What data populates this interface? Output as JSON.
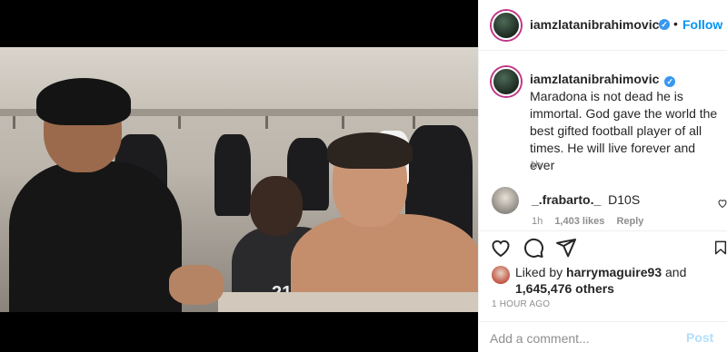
{
  "post": {
    "username": "iamzlatanibrahimovic",
    "verified_icon": "verified-badge-icon",
    "follow_label": "Follow",
    "dot_separator": "•",
    "caption_text": "Maradona is not dead he is immortal. God gave the world the best gifted football player of all times. He will live forever and ever",
    "caption_time": "1h",
    "jersey_number": "21"
  },
  "comments": [
    {
      "username": "_.frabarto._",
      "text": "D10S",
      "time": "1h",
      "likes": "1,403 likes",
      "reply_label": "Reply"
    }
  ],
  "actions": {
    "like_icon": "heart-icon",
    "comment_icon": "comment-icon",
    "share_icon": "share-icon",
    "save_icon": "bookmark-icon"
  },
  "likes": {
    "prefix": "Liked by",
    "user": "harrymaguire93",
    "connector": "and",
    "count": "1,645,476 others"
  },
  "post_time": "1 HOUR AGO",
  "comment_box": {
    "placeholder": "Add a comment...",
    "post_label": "Post"
  },
  "colors": {
    "accent": "#0095f6",
    "verified": "#3897f0",
    "muted": "#8e8e8e",
    "text": "#262626",
    "post_disabled": "#b2dffc"
  }
}
